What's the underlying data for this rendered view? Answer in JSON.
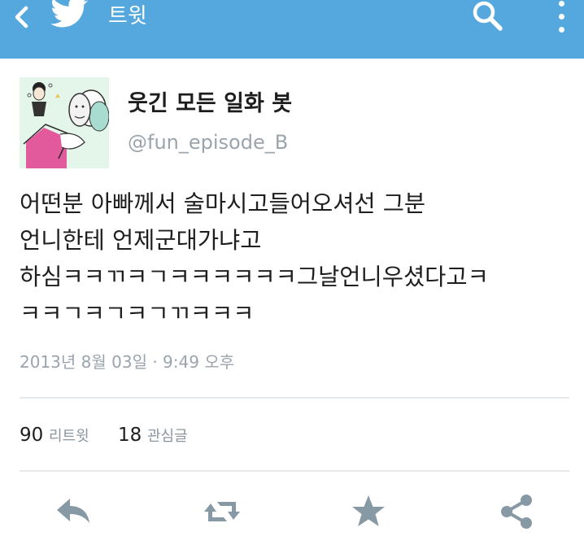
{
  "header": {
    "title": "트윗",
    "icons": [
      "back-icon",
      "twitter-bird-icon",
      "search-icon",
      "more-vert-icon"
    ],
    "color": "#54a8de"
  },
  "user": {
    "display_name": "웃긴 모든 일화 봇",
    "handle": "@fun_episode_B"
  },
  "tweet": {
    "lines": [
      "어떤분 아빠께서 술마시고들어오셔선 그분",
      "언니한테 언제군대가냐고",
      "하심ㅋㅋㄲㅋㄱㅋㅋㅋㅋㅋㅋ그날언니우셨다고ㅋ",
      "ㅋㅋㄱㅋㄱㅋㄱㄲㅋㅋㅋ"
    ],
    "timestamp": "2013년 8월 03일 · 9:49 오후"
  },
  "stats": {
    "retweets": "90",
    "retweets_label": "리트윗",
    "favorites": "18",
    "favorites_label": "관심글"
  },
  "actions": [
    "reply-icon",
    "retweet-icon",
    "favorite-star-icon",
    "share-icon"
  ]
}
